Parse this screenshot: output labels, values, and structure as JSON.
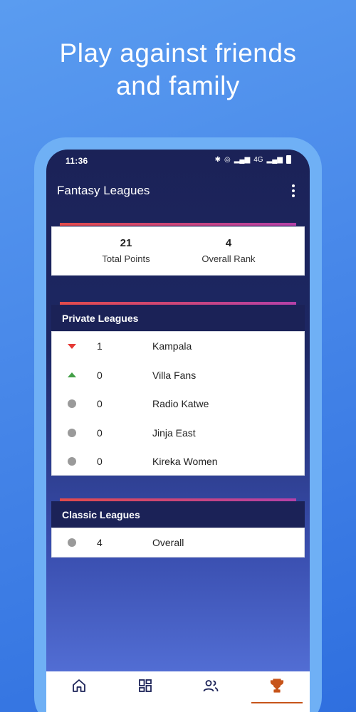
{
  "promo": {
    "title_line1": "Play against friends",
    "title_line2": "and family"
  },
  "status_bar": {
    "time": "11:36",
    "network": "4G"
  },
  "app_bar": {
    "title": "Fantasy Leagues"
  },
  "stats": {
    "total_points_value": "21",
    "total_points_label": "Total Points",
    "overall_rank_value": "4",
    "overall_rank_label": "Overall Rank"
  },
  "private_leagues": {
    "header": "Private Leagues",
    "rows": [
      {
        "movement": "down",
        "rank": "1",
        "name": "Kampala"
      },
      {
        "movement": "up",
        "rank": "0",
        "name": "Villa Fans"
      },
      {
        "movement": "same",
        "rank": "0",
        "name": "Radio Katwe"
      },
      {
        "movement": "same",
        "rank": "0",
        "name": "Jinja East"
      },
      {
        "movement": "same",
        "rank": "0",
        "name": "Kireka Women"
      }
    ]
  },
  "classic_leagues": {
    "header": "Classic Leagues",
    "rows": [
      {
        "movement": "same",
        "rank": "4",
        "name": "Overall"
      }
    ]
  },
  "bottom_nav": {
    "items": [
      {
        "icon": "home-icon"
      },
      {
        "icon": "grid-icon"
      },
      {
        "icon": "people-icon"
      },
      {
        "icon": "trophy-icon",
        "active": true
      }
    ],
    "active_color": "#c7541a"
  },
  "colors": {
    "movement_down": "#e53935",
    "movement_up": "#43a047",
    "movement_same": "#9a9a9a",
    "header_bg": "#1b2257"
  }
}
